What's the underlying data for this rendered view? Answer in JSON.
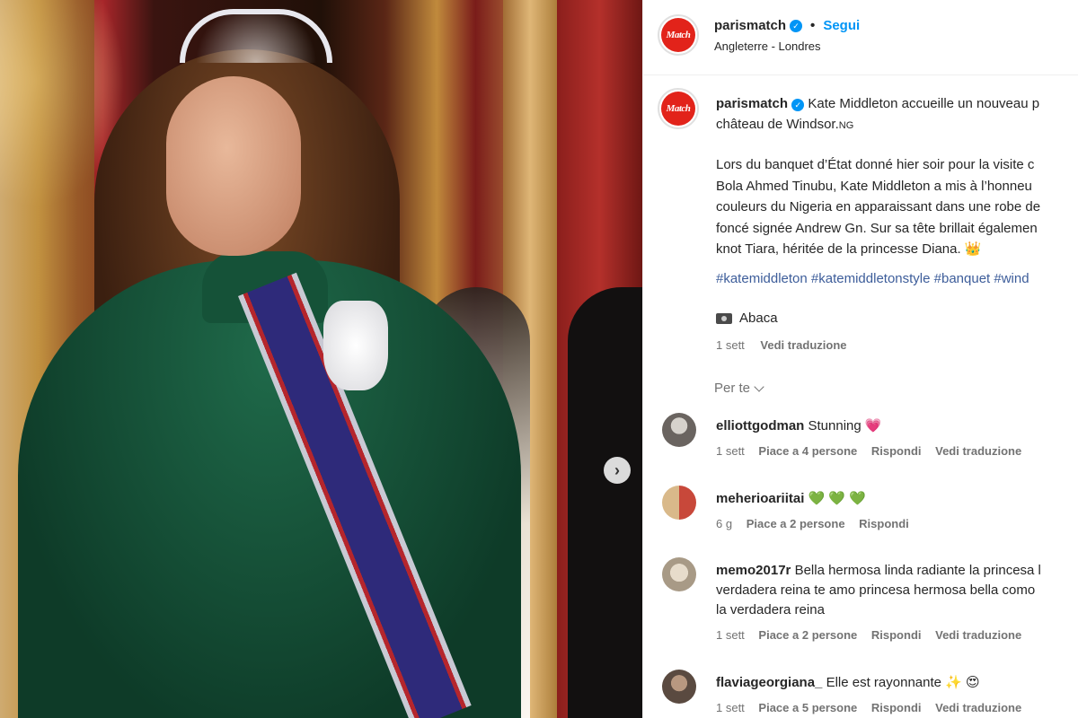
{
  "post": {
    "username": "parismatch",
    "follow_label": "Segui",
    "dot": "•",
    "location": "Angleterre - Londres",
    "avatar_text": "Match",
    "caption_first": "Kate Middleton accueille un nouveau p",
    "caption_second": "château de Windsor.",
    "caption_ng": "NG",
    "paragraph": [
      "Lors du banquet d’État donné hier soir pour la visite c",
      "Bola Ahmed Tinubu, Kate Middleton a mis à l’honneu",
      "couleurs du Nigeria en apparaissant dans une robe de",
      "foncé signée Andrew Gn. Sur sa tête brillait égalemen",
      "knot Tiara, héritée de la princesse Diana. 👑"
    ],
    "hashtags": "#katemiddleton #katemiddletonstyle #banquet #wind",
    "credit": "Abaca",
    "time": "1 sett",
    "translate_label": "Vedi traduzione",
    "for_you_label": "Per te"
  },
  "comments": [
    {
      "user": "elliottgodman",
      "text": "Stunning",
      "emoji": "💗",
      "emoji_class": "heart-pink",
      "extra_lines": [],
      "time": "1 sett",
      "likes": "Piace a 4 persone",
      "reply": "Rispondi",
      "translate": "Vedi traduzione"
    },
    {
      "user": "meherioariitai",
      "text": "",
      "emoji": "💚 💚 💚",
      "emoji_class": "heart-green",
      "extra_lines": [],
      "time": "6 g",
      "likes": "Piace a 2 persone",
      "reply": "Rispondi",
      "translate": ""
    },
    {
      "user": "memo2017r",
      "text": "Bella hermosa linda radiante la princesa l",
      "emoji": "",
      "emoji_class": "",
      "extra_lines": [
        "verdadera reina te amo princesa hermosa bella como",
        "la verdadera reina"
      ],
      "time": "1 sett",
      "likes": "Piace a 2 persone",
      "reply": "Rispondi",
      "translate": "Vedi traduzione"
    },
    {
      "user": "flaviageorgiana_",
      "text": "Elle est rayonnante",
      "emoji": "✨ 😍",
      "emoji_class": "",
      "extra_lines": [],
      "time": "1 sett",
      "likes": "Piace a 5 persone",
      "reply": "Rispondi",
      "translate": "Vedi traduzione"
    }
  ],
  "icons": {
    "next": "chevron-right-icon",
    "verified": "verified-badge-icon",
    "camera": "camera-icon",
    "chevron_down": "chevron-down-icon"
  },
  "colors": {
    "accent": "#0095f6",
    "hashtag": "#3d5d9a",
    "muted": "#737373",
    "brand_red": "#e2231a"
  }
}
